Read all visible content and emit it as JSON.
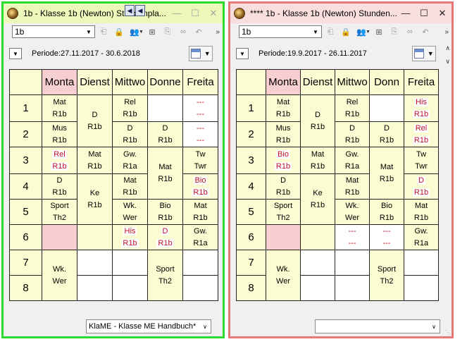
{
  "windows": [
    {
      "id": "left",
      "title": "1b - Klasse 1b (Newton)  Stundenpla...",
      "class_value": "1b",
      "period": "Periode:27.11.2017 - 30.6.2018",
      "days": [
        "Monta",
        "Dienst",
        "Mittwo",
        "Donne",
        "Freita"
      ],
      "periods": [
        "1",
        "2",
        "3",
        "4",
        "5",
        "6",
        "7",
        "8"
      ],
      "cells": {
        "mo1": [
          "Mat",
          "R1b"
        ],
        "mo2": [
          "Mus",
          "R1b"
        ],
        "mo3": [
          "Rel",
          "R1b"
        ],
        "mo4": [
          "D",
          "R1b"
        ],
        "mo5": [
          "Sport",
          "Th2"
        ],
        "mo78": [
          "Wk.",
          "Wer"
        ],
        "di12": [
          "D",
          "R1b"
        ],
        "di3": [
          "Mat",
          "R1b"
        ],
        "di45": [
          "Ke",
          "R1b"
        ],
        "mi1": [
          "Rel",
          "R1b"
        ],
        "mi2": [
          "D",
          "R1b"
        ],
        "mi3": [
          "Gw.",
          "R1a"
        ],
        "mi4": [
          "Mat",
          "R1b"
        ],
        "mi5": [
          "Wk.",
          "Wer"
        ],
        "mi6": [
          "His",
          "R1b"
        ],
        "do2": [
          "D",
          "R1b"
        ],
        "do34": [
          "Mat",
          "R1b"
        ],
        "do5": [
          "Bio",
          "R1b"
        ],
        "do6": [
          "D",
          "R1b"
        ],
        "do78": [
          "Sport",
          "Th2"
        ],
        "fr1": [
          "---",
          "---"
        ],
        "fr2": [
          "---",
          "---"
        ],
        "fr3": [
          "Tw",
          "Twr"
        ],
        "fr4": [
          "Bio",
          "R1b"
        ],
        "fr5": [
          "Mat",
          "R1b"
        ],
        "fr6": [
          "Gw.",
          "R1a"
        ]
      },
      "status_select": "KlaME - Klasse ME Handbuch*"
    },
    {
      "id": "right",
      "title": "**** 1b - Klasse 1b (Newton)  Stunden...",
      "class_value": "1b",
      "period": "Periode:19.9.2017 - 26.11.2017",
      "days": [
        "Monta",
        "Dienst",
        "Mittwo",
        "Donn",
        "Freita"
      ],
      "periods": [
        "1",
        "2",
        "3",
        "4",
        "5",
        "6",
        "7",
        "8"
      ],
      "cells": {
        "mo1": [
          "Mat",
          "R1b"
        ],
        "mo2": [
          "Mus",
          "R1b"
        ],
        "mo3": [
          "Bio",
          "R1b"
        ],
        "mo4": [
          "D",
          "R1b"
        ],
        "mo5": [
          "Sport",
          "Th2"
        ],
        "mo78": [
          "Wk.",
          "Wer"
        ],
        "di12": [
          "D",
          "R1b"
        ],
        "di3": [
          "Mat",
          "R1b"
        ],
        "di45": [
          "Ke",
          "R1b"
        ],
        "mi1": [
          "Rel",
          "R1b"
        ],
        "mi2": [
          "D",
          "R1b"
        ],
        "mi3": [
          "Gw.",
          "R1a"
        ],
        "mi4": [
          "Mat",
          "R1b"
        ],
        "mi5": [
          "Wk.",
          "Wer"
        ],
        "mi6": [
          "---",
          "---"
        ],
        "do2": [
          "D",
          "R1b"
        ],
        "do34": [
          "Mat",
          "R1b"
        ],
        "do5": [
          "Bio",
          "R1b"
        ],
        "do6": [
          "---",
          "---"
        ],
        "do78": [
          "Sport",
          "Th2"
        ],
        "fr1": [
          "His",
          "R1b"
        ],
        "fr2": [
          "Rel",
          "R1b"
        ],
        "fr3": [
          "Tw",
          "Twr"
        ],
        "fr4": [
          "D",
          "R1b"
        ],
        "fr5": [
          "Mat",
          "R1b"
        ],
        "fr6": [
          "Gw.",
          "R1a"
        ]
      },
      "status_select": ""
    }
  ],
  "icons": {
    "lock": "lock-icon",
    "users": "users-icon",
    "grid": "grid-icon",
    "more": "chevron-double-right-icon"
  },
  "colors": {
    "left_border": "#2cdb2c",
    "right_border": "#e87878",
    "cell_bg": "#fcfcd2",
    "highlight": "#f8cfd0",
    "changed_text": "#c0102a"
  }
}
